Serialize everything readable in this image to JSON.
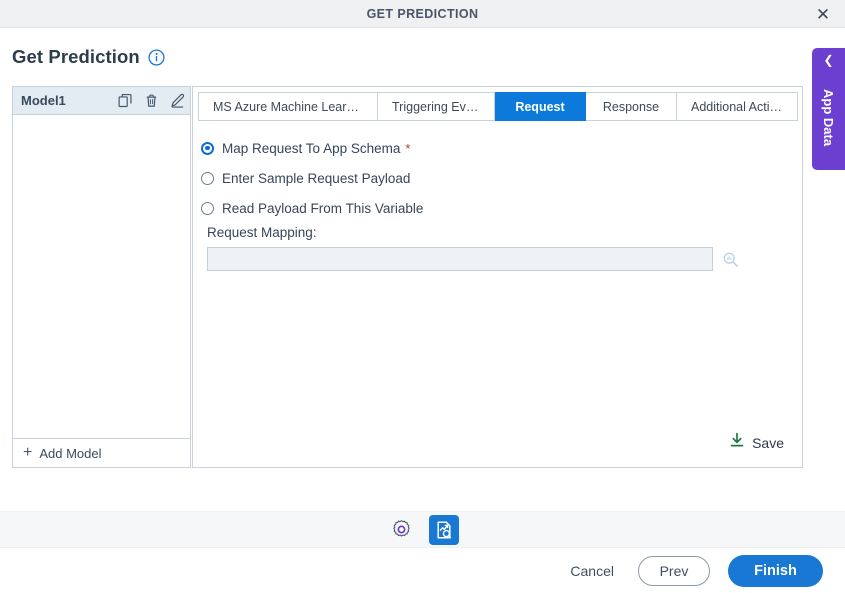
{
  "window": {
    "title": "GET PREDICTION",
    "close_icon": "close-x-icon"
  },
  "page": {
    "title": "Get Prediction",
    "info_icon": "info-circle-icon"
  },
  "model_panel": {
    "model_name": "Model1",
    "copy_icon": "copy-icon",
    "delete_icon": "trash-icon",
    "edit_icon": "pencil-icon",
    "add_model_label": "Add Model",
    "add_icon": "plus-icon"
  },
  "tabs": [
    {
      "label": "MS Azure Machine Lear…",
      "active": false
    },
    {
      "label": "Triggering Ev…",
      "active": false
    },
    {
      "label": "Request",
      "active": true
    },
    {
      "label": "Response",
      "active": false
    },
    {
      "label": "Additional Acti…",
      "active": false
    }
  ],
  "request_tab": {
    "options": [
      {
        "label": "Map Request To App Schema",
        "required": "*",
        "selected": true
      },
      {
        "label": "Enter Sample Request Payload",
        "required": "",
        "selected": false
      },
      {
        "label": "Read Payload From This Variable",
        "required": "",
        "selected": false
      }
    ],
    "mapping_label": "Request Mapping:",
    "mapping_value": "",
    "mapping_placeholder": "",
    "mapping_search_icon": "search-icon",
    "save_label": "Save",
    "save_icon": "download-icon"
  },
  "app_data": {
    "label": "App Data",
    "chevron_icon": "chevron-left-icon"
  },
  "toolbar": {
    "settings_icon": "gear-icon",
    "preview_icon": "report-preview-icon"
  },
  "footer": {
    "cancel_label": "Cancel",
    "prev_label": "Prev",
    "finish_label": "Finish"
  },
  "colors": {
    "accent_blue": "#1878d4",
    "tab_active": "#0b7ada",
    "app_data_purple": "#6d3fd1",
    "save_green": "#1f7a42",
    "required_red": "#c0392b",
    "titlebar_bg": "#eff0f2"
  }
}
